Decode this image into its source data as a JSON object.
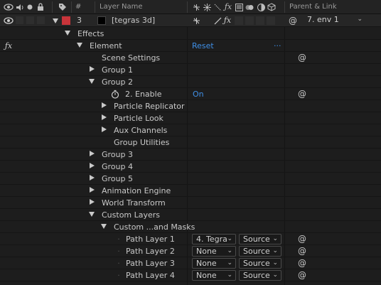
{
  "header": {
    "hash": "#",
    "layer_name": "Layer Name",
    "parent_link": "Parent & Link"
  },
  "layer": {
    "number": "3",
    "name": "[tegras 3d]",
    "label_color": "#c8343a",
    "parent": "7. env 1"
  },
  "tree": {
    "effects": "Effects",
    "element": "Element",
    "element_reset": "Reset",
    "element_more": "...",
    "scene_settings": "Scene Settings",
    "group1": "Group 1",
    "group2": "Group 2",
    "enable_label": "2. Enable",
    "enable_value": "On",
    "particle_replicator": "Particle Replicator",
    "particle_look": "Particle Look",
    "aux_channels": "Aux Channels",
    "group_utilities": "Group Utilities",
    "group3": "Group 3",
    "group4": "Group 4",
    "group5": "Group 5",
    "animation_engine": "Animation Engine",
    "world_transform": "World Transform",
    "custom_layers": "Custom Layers",
    "custom_masks": "Custom ...and Masks",
    "paths": [
      {
        "label": "Path Layer 1",
        "layer": "4. Tegra",
        "source": "Source"
      },
      {
        "label": "Path Layer 2",
        "layer": "None",
        "source": "Source"
      },
      {
        "label": "Path Layer 3",
        "layer": "None",
        "source": "Source"
      },
      {
        "label": "Path Layer 4",
        "layer": "None",
        "source": "Source"
      }
    ]
  },
  "icons": {
    "fx": "fx",
    "swirl": "@"
  }
}
